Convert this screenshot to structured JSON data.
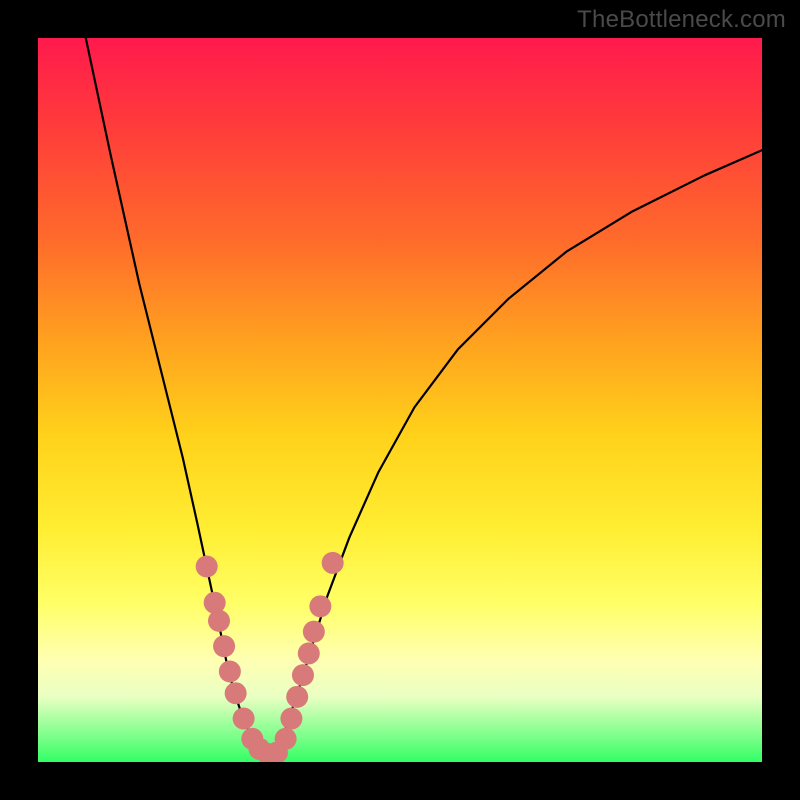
{
  "watermark": "TheBottleneck.com",
  "chart_data": {
    "type": "line",
    "title": "",
    "xlabel": "",
    "ylabel": "",
    "xlim": [
      0,
      100
    ],
    "ylim": [
      0,
      100
    ],
    "series": [
      {
        "name": "left-curve",
        "x": [
          6.6,
          10,
          12,
          14,
          16,
          18,
          20,
          22,
          23.5,
          25,
          26,
          27,
          28,
          29,
          30,
          31,
          31.8
        ],
        "values": [
          100,
          84,
          75,
          66,
          58,
          50,
          42,
          33,
          26,
          19,
          14,
          10,
          7,
          4.5,
          2.8,
          1.6,
          1.1
        ]
      },
      {
        "name": "right-curve",
        "x": [
          31.8,
          33,
          34,
          36,
          38,
          40,
          43,
          47,
          52,
          58,
          65,
          73,
          82,
          92,
          100
        ],
        "values": [
          1.1,
          2,
          4,
          10,
          16.5,
          23,
          31,
          40,
          49,
          57,
          64,
          70.5,
          76,
          81,
          84.5
        ]
      }
    ],
    "markers": {
      "name": "data-points",
      "color": "#d87a7a",
      "points": [
        {
          "x": 23.3,
          "y": 27
        },
        {
          "x": 24.4,
          "y": 22
        },
        {
          "x": 25.0,
          "y": 19.5
        },
        {
          "x": 25.7,
          "y": 16
        },
        {
          "x": 26.5,
          "y": 12.5
        },
        {
          "x": 27.3,
          "y": 9.5
        },
        {
          "x": 28.4,
          "y": 6
        },
        {
          "x": 29.6,
          "y": 3.2
        },
        {
          "x": 30.6,
          "y": 1.8
        },
        {
          "x": 31.8,
          "y": 1.1
        },
        {
          "x": 33.0,
          "y": 1.3
        },
        {
          "x": 34.2,
          "y": 3.2
        },
        {
          "x": 35.0,
          "y": 6
        },
        {
          "x": 35.8,
          "y": 9
        },
        {
          "x": 36.6,
          "y": 12
        },
        {
          "x": 37.4,
          "y": 15
        },
        {
          "x": 38.1,
          "y": 18
        },
        {
          "x": 39.0,
          "y": 21.5
        },
        {
          "x": 40.7,
          "y": 27.5
        }
      ]
    }
  }
}
